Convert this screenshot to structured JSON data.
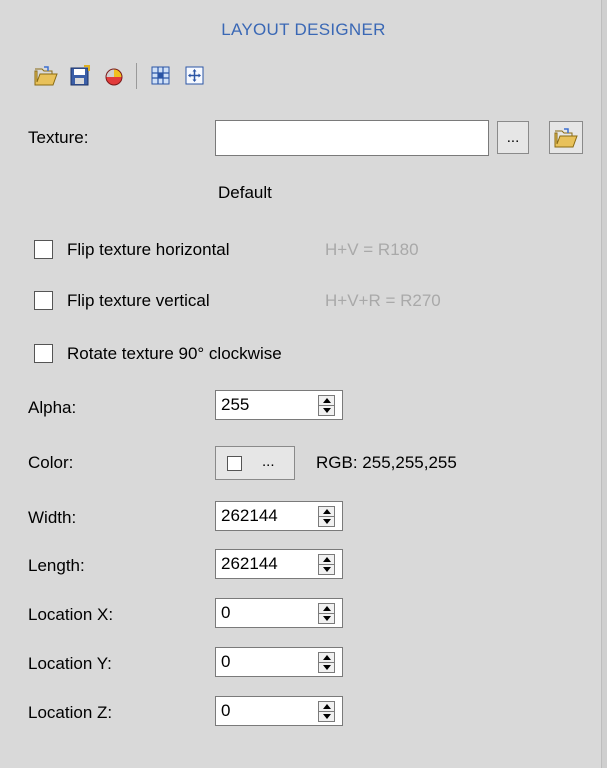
{
  "header": {
    "title": "LAYOUT DESIGNER"
  },
  "toolbar": {
    "icons": [
      "open-folder-icon",
      "save-icon",
      "color-wheel-icon",
      "grid-layout-icon",
      "move-icon"
    ]
  },
  "texture": {
    "label": "Texture:",
    "value": "",
    "browse_label": "...",
    "current": "Default"
  },
  "options": {
    "flip_h_label": "Flip texture horizontal",
    "flip_h_hint": "H+V = R180",
    "flip_v_label": "Flip texture vertical",
    "flip_v_hint": "H+V+R = R270",
    "rotate_label": "Rotate texture 90° clockwise",
    "flip_h_checked": false,
    "flip_v_checked": false,
    "rotate_checked": false
  },
  "alpha": {
    "label": "Alpha:",
    "value": "255"
  },
  "color": {
    "label": "Color:",
    "button_label": "...",
    "rgb": "RGB: 255,255,255",
    "swatch": "#ffffff"
  },
  "width": {
    "label": "Width:",
    "value": "262144"
  },
  "length": {
    "label": "Length:",
    "value": "262144"
  },
  "location_x": {
    "label": "Location X:",
    "value": "0"
  },
  "location_y": {
    "label": "Location Y:",
    "value": "0"
  },
  "location_z": {
    "label": "Location Z:",
    "value": "0"
  },
  "colors": {
    "title": "#3a68b5",
    "panel_bg": "#d9d9d9",
    "hint": "#a9a9a9"
  }
}
